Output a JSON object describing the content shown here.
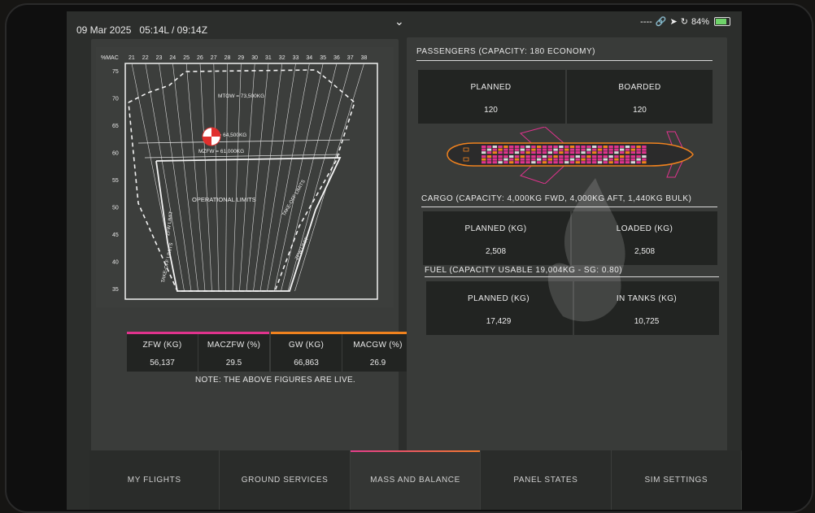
{
  "status": {
    "date": "09 Mar 2025",
    "time": "05:14L / 09:14Z",
    "signal": "----",
    "battery": "84%",
    "battery_level": 0.84
  },
  "colors": {
    "zfw_accent": "#e0338d",
    "gw_accent": "#f0821e",
    "cabin_line": "#e0338d",
    "fuselage": "#f0821e"
  },
  "envelope": {
    "mac_label": "%MAC",
    "mac_ticks": [
      "21",
      "22",
      "23",
      "24",
      "25",
      "26",
      "27",
      "28",
      "29",
      "30",
      "31",
      "32",
      "33",
      "34",
      "35",
      "36",
      "37",
      "38"
    ],
    "weight_ticks": [
      "75",
      "70",
      "65",
      "60",
      "55",
      "50",
      "45",
      "40",
      "35"
    ],
    "labels": {
      "mtow": "MTOW = 73,500KG",
      "mlw": "MLW = 64,500KG",
      "mzfw": "MZFW = 61,000KG",
      "operational": "OPERATIONAL LIMITS",
      "zfw_limit_left": "ZFW LIMIT",
      "zfw_limit_right": "ZFW LIMIT",
      "takeoff_left": "TAKE-OFF LIMITS",
      "takeoff_right": "TAKE-OFF LIMITS"
    }
  },
  "weights": {
    "zfw_label": "ZFW (KG)",
    "zfw_value": "56,137",
    "maczfw_label": "MACZFW (%)",
    "maczfw_value": "29.5",
    "gw_label": "GW (KG)",
    "gw_value": "66,863",
    "macgw_label": "MACGW (%)",
    "macgw_value": "26.9"
  },
  "note": "NOTE: THE ABOVE FIGURES ARE LIVE.",
  "passengers": {
    "title": "PASSENGERS (CAPACITY: 180 ECONOMY)",
    "planned_label": "PLANNED",
    "planned_value": "120",
    "boarded_label": "BOARDED",
    "boarded_value": "120"
  },
  "cargo": {
    "title": "CARGO (CAPACITY: 4,000KG FWD, 4,000KG AFT, 1,440KG BULK)",
    "planned_label": "PLANNED (KG)",
    "planned_value": "2,508",
    "loaded_label": "LOADED (KG)",
    "loaded_value": "2,508"
  },
  "fuel": {
    "title": "FUEL (CAPACITY USABLE 19,004KG - SG: 0.80)",
    "planned_label": "PLANNED (KG)",
    "planned_value": "17,429",
    "tanks_label": "IN TANKS (KG)",
    "tanks_value": "10,725"
  },
  "tabs": [
    {
      "label": "MY FLIGHTS"
    },
    {
      "label": "GROUND SERVICES"
    },
    {
      "label": "MASS AND BALANCE"
    },
    {
      "label": "PANEL STATES"
    },
    {
      "label": "SIM SETTINGS"
    }
  ]
}
